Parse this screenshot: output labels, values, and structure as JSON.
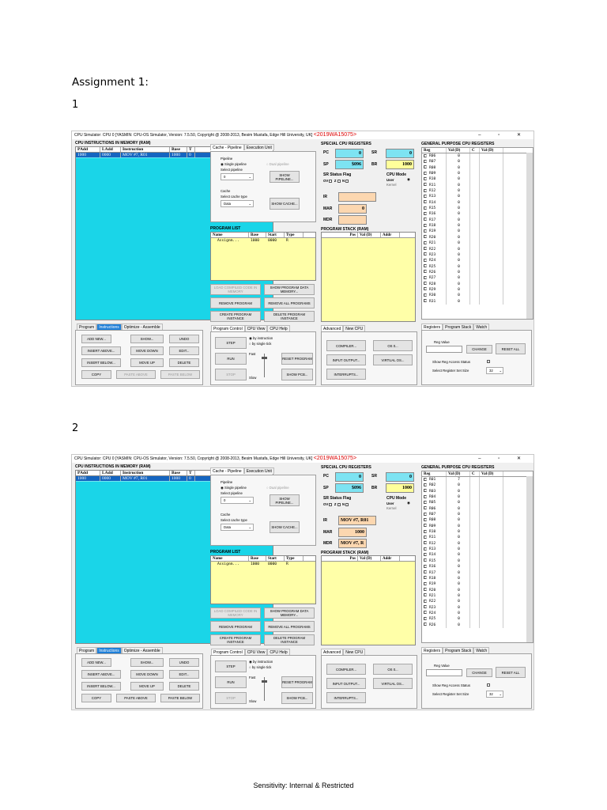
{
  "document": {
    "heading": "Assignment 1:",
    "section1": "1",
    "section2": "2",
    "footer": "Sensitivity: Internal & Restricted"
  },
  "window": {
    "title": "CPU Simulator: CPU 0    [YASMIN: CPU-OS Simulator,  Version: 7.5.50,  Copyright @ 2008-2013, Besim Mustafa, Edge Hill University, UK]",
    "reg_id": "<2019WA15075>",
    "controls": "– ▫ ✕"
  },
  "instructions_panel": {
    "title": "CPU INSTRUCTIONS IN MEMORY (RAM)",
    "columns": [
      "PAdd",
      "LAdd",
      "Instruction",
      "Base",
      "T"
    ],
    "rows_shot1": [
      [
        "1000",
        "0000",
        "MOV #7, R01",
        "1000",
        "0"
      ]
    ],
    "rows_shot2": [
      [
        "1000",
        "0000",
        "MOV #7, R01",
        "1000",
        "0"
      ]
    ]
  },
  "left_tabs": {
    "program": "Program",
    "instructions": "Instructions",
    "optimize": "Optimize - Assemble"
  },
  "left_buttons": {
    "add_new": "ADD NEW...",
    "show": "SHOW...",
    "undo": "UNDO",
    "insert_above": "INSERT ABOVE...",
    "move_down": "MOVE DOWN",
    "edit": "EDIT...",
    "insert_below": "INSERT BELOW...",
    "move_up": "MOVE UP",
    "delete": "DELETE",
    "copy": "COPY",
    "paste_above": "PASTE ABOVE",
    "paste_below": "PASTE BELOW"
  },
  "pipeline": {
    "tab_cache": "Cache - Pipeline",
    "tab_exec": "Execution Unit",
    "pipeline_label": "Pipeline",
    "single": "Single pipeline",
    "dual": "Dual pipeline",
    "select_pipeline": "Select pipeline",
    "pipeline_value": "0",
    "show_pipeline": "SHOW PIPELINE...",
    "cache_label": "Cache",
    "select_cache": "Select cache type",
    "cache_value": "Data",
    "show_cache": "SHOW CACHE..."
  },
  "program_list": {
    "title": "PROGRAM LIST",
    "columns": [
      "Name",
      "Base",
      "Start",
      "Type"
    ],
    "rows": [
      [
        "Assignm...",
        "1000",
        "0000",
        "R"
      ]
    ],
    "load_compiled": "LOAD COMPILED CODE IN MEMORY",
    "show_program": "SHOW PROGRAM DATA MEMORY...",
    "remove_program": "REMOVE PROGRAM",
    "remove_all": "REMOVE ALL PROGRAMS",
    "create_instance": "CREATE PROGRAM INSTANCE",
    "delete_instance": "DELETE PROGRAM INSTANCE"
  },
  "program_control": {
    "tab_control": "Program Control",
    "tab_view": "CPU View",
    "tab_help": "CPU Help",
    "step": "STEP",
    "by_instruction": "by instruction",
    "by_tick": "by single tick",
    "run": "RUN",
    "reset": "RESET PROGRAM",
    "stop": "STOP",
    "show_pcb": "SHOW PCB...",
    "fast": "Fast",
    "slow": "Slow"
  },
  "special_regs": {
    "title": "SPECIAL CPU REGISTERS",
    "pc": "PC",
    "sr": "SR",
    "sp": "SP",
    "br": "BR",
    "status_flag": "SR Status Flag",
    "cpu_mode": "CPU Mode",
    "ov": "OV",
    "z": "Z",
    "n": "N",
    "user": "User",
    "kernel": "Kernel",
    "ir": "IR",
    "mar": "MAR",
    "mdr": "MDR",
    "shot1": {
      "pc": "0",
      "sr": "0",
      "sp": "$096",
      "br": "1000",
      "ir": "",
      "mar": "0",
      "mdr": ""
    },
    "shot2": {
      "pc": "0",
      "sr": "0",
      "sp": "$096",
      "br": "1000",
      "ir": "MOV #7, R01",
      "mar": "1000",
      "mdr": "MOV #7, R"
    }
  },
  "program_stack": {
    "title": "PROGRAM STACK (RAM)",
    "columns": [
      "Pos",
      "Val (D)",
      "Addr"
    ]
  },
  "advanced": {
    "tab_advanced": "Advanced",
    "tab_newcpu": "New CPU",
    "compiler": "COMPILER...",
    "os": "OS 0...",
    "io": "INPUT OUTPUT...",
    "virtual": "VIRTUAL OS...",
    "interrupts": "INTERRUPTS..."
  },
  "gp_regs": {
    "title": "GENERAL PURPOSE CPU REGISTERS",
    "columns": [
      "Reg",
      "Val (D)",
      "C",
      "Val (D)"
    ],
    "shot1": [
      [
        "R06",
        "0"
      ],
      [
        "R07",
        "0"
      ],
      [
        "R08",
        "0"
      ],
      [
        "R09",
        "0"
      ],
      [
        "R10",
        "0"
      ],
      [
        "R11",
        "0"
      ],
      [
        "R12",
        "0"
      ],
      [
        "R13",
        "0"
      ],
      [
        "R14",
        "0"
      ],
      [
        "R15",
        "0"
      ],
      [
        "R16",
        "0"
      ],
      [
        "R17",
        "0"
      ],
      [
        "R18",
        "0"
      ],
      [
        "R19",
        "0"
      ],
      [
        "R20",
        "0"
      ],
      [
        "R21",
        "0"
      ],
      [
        "R22",
        "0"
      ],
      [
        "R23",
        "0"
      ],
      [
        "R24",
        "0"
      ],
      [
        "R25",
        "0"
      ],
      [
        "R26",
        "0"
      ],
      [
        "R27",
        "0"
      ],
      [
        "R28",
        "0"
      ],
      [
        "R29",
        "0"
      ],
      [
        "R30",
        "0"
      ],
      [
        "R31",
        "0"
      ]
    ],
    "shot2": [
      [
        "R01",
        "7"
      ],
      [
        "R02",
        "0"
      ],
      [
        "R03",
        "0"
      ],
      [
        "R04",
        "0"
      ],
      [
        "R05",
        "0"
      ],
      [
        "R06",
        "0"
      ],
      [
        "R07",
        "0"
      ],
      [
        "R08",
        "0"
      ],
      [
        "R09",
        "0"
      ],
      [
        "R10",
        "0"
      ],
      [
        "R11",
        "0"
      ],
      [
        "R12",
        "0"
      ],
      [
        "R13",
        "0"
      ],
      [
        "R14",
        "0"
      ],
      [
        "R15",
        "0"
      ],
      [
        "R16",
        "0"
      ],
      [
        "R17",
        "0"
      ],
      [
        "R18",
        "0"
      ],
      [
        "R19",
        "0"
      ],
      [
        "R20",
        "0"
      ],
      [
        "R21",
        "0"
      ],
      [
        "R22",
        "0"
      ],
      [
        "R23",
        "0"
      ],
      [
        "R24",
        "0"
      ],
      [
        "R25",
        "0"
      ],
      [
        "R26",
        "0"
      ]
    ]
  },
  "registers_panel": {
    "tab_registers": "Registers",
    "tab_stack": "Program Stack",
    "tab_watch": "Watch",
    "reg_value": "Reg Value",
    "change": "CHANGE",
    "reset_all": "RESET ALL",
    "show_access": "Show Reg Access Status",
    "select_set": "Select Register Set Size",
    "set_value": "32"
  }
}
